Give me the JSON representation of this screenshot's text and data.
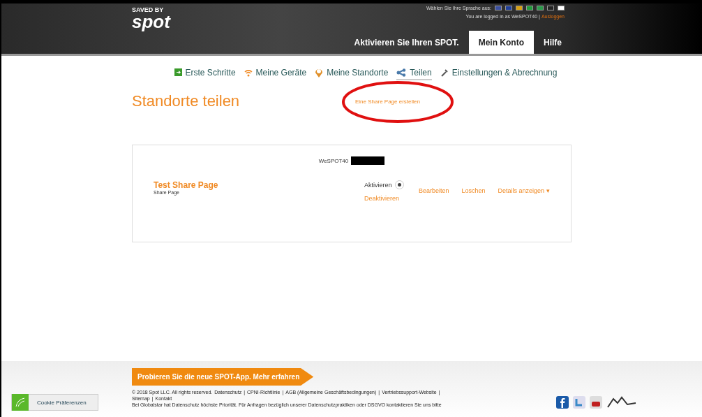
{
  "header": {
    "logo_top": "SAVED BY",
    "logo": "spot",
    "language_label": "Wählen Sie Ihre Sprache aus:",
    "flags": [
      {
        "color": "#3a4fa0"
      },
      {
        "color": "#1f3f9a"
      },
      {
        "color": "#d8a010"
      },
      {
        "color": "#1f9a3a"
      },
      {
        "color": "#2a9a4a"
      },
      {
        "color": "#222222"
      },
      {
        "color": "#ffffff"
      }
    ],
    "login_text": "You are logged in as WeSPOT40 |",
    "logout": "Ausloggen",
    "tabs": [
      {
        "label": "Aktivieren Sie Ihren SPOT.",
        "selected": false
      },
      {
        "label": "Mein Konto",
        "selected": true
      },
      {
        "label": "Hilfe",
        "selected": false
      }
    ]
  },
  "subnav": [
    {
      "label": "Erste Schritte",
      "kind": "start",
      "selected": false
    },
    {
      "label": "Meine Geräte",
      "kind": "devices",
      "selected": false
    },
    {
      "label": "Meine Standorte",
      "kind": "locations",
      "selected": false
    },
    {
      "label": "Teilen",
      "kind": "share",
      "selected": true
    },
    {
      "label": "Einstellungen & Abrechnung",
      "kind": "settings",
      "selected": false
    }
  ],
  "page_title": "Standorte teilen",
  "create_link": "Eine Share Page erstellen",
  "panel": {
    "account": "WeSPOT40",
    "share_pages": [
      {
        "name": "Test Share Page",
        "type": "Share Page",
        "activate": "Aktivieren",
        "active": true,
        "deactivate": "Deaktivieren",
        "edit": "Bearbeiten",
        "delete": "Loschen",
        "details": "Details anzeigen",
        "details_caret": "▾"
      }
    ]
  },
  "footer": {
    "promo": "Probieren Sie die neue SPOT-App. Mehr erfahren",
    "cookie": "Cookie Präferenzen",
    "separator": "|",
    "links": [
      "Datenschutz",
      "CPNI-Richtlinie",
      "AGB (Allgemeine Geschäftsbedingungen)",
      "Vertriebssupport-Website",
      "Sitemap",
      "Kontakt"
    ],
    "copyright": "© 2018 Spot LLC. All rights reserved.",
    "privacy": "Bei Globalstar hat Datenschutz höchste Priorität. Für Anfragen bezüglich unserer Datenschutzpraktiken oder DSGVO kontaktieren Sie uns bitte"
  }
}
